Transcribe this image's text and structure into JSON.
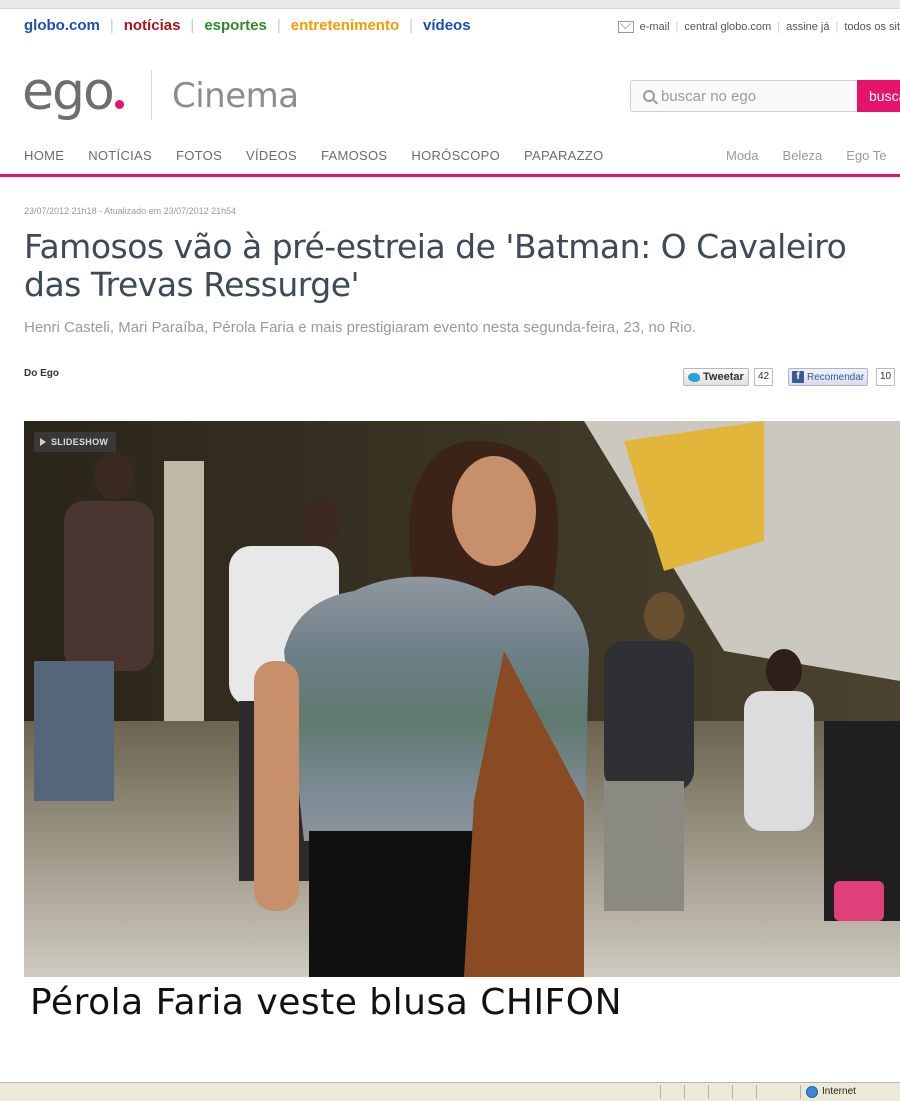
{
  "globo_bar": {
    "links": [
      {
        "label": "globo.com",
        "cls": "c-globo"
      },
      {
        "label": "notícias",
        "cls": "c-noticias"
      },
      {
        "label": "esportes",
        "cls": "c-esportes"
      },
      {
        "label": "entretenimento",
        "cls": "c-entret"
      },
      {
        "label": "vídeos",
        "cls": "c-videos"
      }
    ],
    "right_links": [
      "e-mail",
      "central globo.com",
      "assine já",
      "todos os sit"
    ]
  },
  "header": {
    "logo": "ego",
    "section": "Cinema",
    "search_placeholder": "buscar no ego",
    "search_button": "busca"
  },
  "nav": {
    "left": [
      "HOME",
      "NOTÍCIAS",
      "FOTOS",
      "VÍDEOS",
      "FAMOSOS",
      "HORÓSCOPO",
      "PAPARAZZO"
    ],
    "right": [
      "Moda",
      "Beleza",
      "Ego Te"
    ]
  },
  "article": {
    "dateline": "23/07/2012 21h18 - Atualizado em 23/07/2012 21h54",
    "headline": "Famosos vão à pré-estreia de 'Batman: O Cavaleiro das Trevas Ressurge'",
    "subtitle": "Henri Casteli, Mari Paraíba, Pérola Faria e mais prestigiaram evento nesta segunda-feira, 23, no Rio.",
    "byline": "Do Ego"
  },
  "social": {
    "tweet_label": "Tweetar",
    "tweet_count": "42",
    "fb_label": "Recomendar",
    "fb_count": "10"
  },
  "photo": {
    "slideshow_label": "SLIDESHOW",
    "caption": "Pérola Faria veste blusa CHIFON"
  },
  "statusbar": {
    "zone": "Internet"
  },
  "colors": {
    "accent_pink": "#e6136c",
    "headline_text": "#3d4a58"
  }
}
